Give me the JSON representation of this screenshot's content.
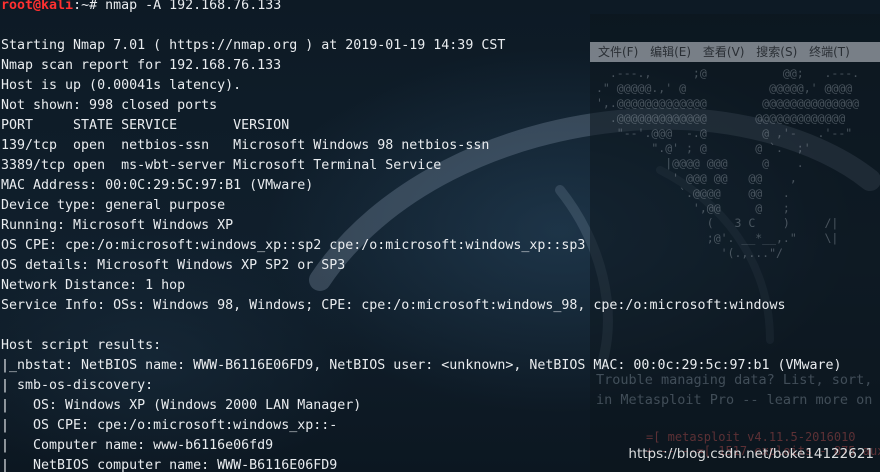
{
  "prompt": {
    "user_host": "root@kali",
    "path": ":~# ",
    "command": "nmap -A 192.168.76.133"
  },
  "output": [
    "",
    "Starting Nmap 7.01 ( https://nmap.org ) at 2019-01-19 14:39 CST",
    "Nmap scan report for 192.168.76.133",
    "Host is up (0.00041s latency).",
    "Not shown: 998 closed ports",
    "PORT     STATE SERVICE       VERSION",
    "139/tcp  open  netbios-ssn   Microsoft Windows 98 netbios-ssn",
    "3389/tcp open  ms-wbt-server Microsoft Terminal Service",
    "MAC Address: 00:0C:29:5C:97:B1 (VMware)",
    "Device type: general purpose",
    "Running: Microsoft Windows XP",
    "OS CPE: cpe:/o:microsoft:windows_xp::sp2 cpe:/o:microsoft:windows_xp::sp3",
    "OS details: Microsoft Windows XP SP2 or SP3",
    "Network Distance: 1 hop",
    "Service Info: OSs: Windows 98, Windows; CPE: cpe:/o:microsoft:windows_98, cpe:/o:microsoft:windows",
    "",
    "Host script results:",
    "|_nbstat: NetBIOS name: WWW-B6116E06FD9, NetBIOS user: <unknown>, NetBIOS MAC: 00:0c:29:5c:97:b1 (VMware)",
    "| smb-os-discovery:",
    "|   OS: Windows XP (Windows 2000 LAN Manager)",
    "|   OS CPE: cpe:/o:microsoft:windows_xp::-",
    "|   Computer name: www-b6116e06fd9",
    "|   NetBIOS computer name: WWW-B6116E06FD9"
  ],
  "background_window": {
    "menu": [
      "文件(F)",
      "编辑(E)",
      "查看(V)",
      "搜索(S)",
      "终端(T)"
    ],
    "ascii_art": "  .---.,      ;@           @@;   .---.\n.\" @@@@@.,' @            @@@@@,' @@@@\n',.@@@@@@@@@@@@@        @@@@@@@@@@@@@@\n  .@@@@@@@@@@@@@       @@@@@@@@@@@@@\n   \"--'.@@@  -.@        @ ,'-   .'--\"\n        \".@' ; @       @ `.  ;'\n          |@@@@ @@@     @    .\n           ' @@@ @@   @@    ,\n            `.@@@@    @@   .\n              ',@@     @   ;\n                (   3 C    )     /|\n                ;@'. __*__,.\"    \\|\n                  '(.,...\"/",
    "tip": "Trouble managing data? List, sort, g\nin Metasploit Pro -- learn more on h",
    "version": "=[ metasploit v4.11.5-2016010\n+ -- --=[ 1517 exploits - 875 auxili"
  },
  "watermark": "https://blog.csdn.net/boke14122621"
}
